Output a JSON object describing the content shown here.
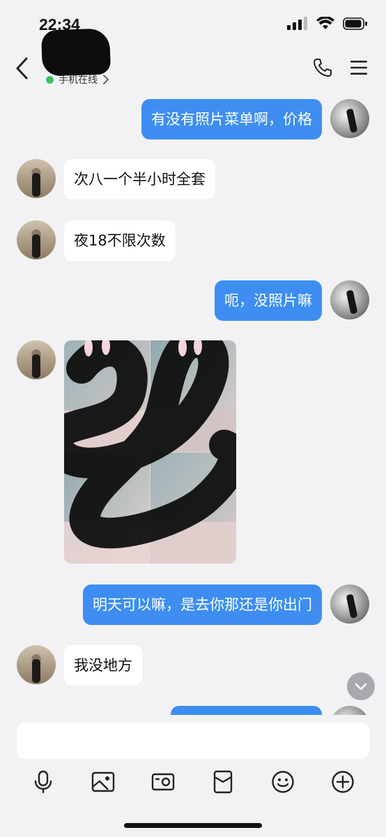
{
  "status": {
    "time": "22:34"
  },
  "header": {
    "presence": "手机在线"
  },
  "messages": [
    {
      "side": "me",
      "text": "有没有照片菜单啊，价格"
    },
    {
      "side": "them",
      "text": "次八一个半小时全套"
    },
    {
      "side": "them",
      "text": "夜18不限次数"
    },
    {
      "side": "me",
      "text": "呃，没照片嘛"
    },
    {
      "side": "them",
      "type": "image"
    },
    {
      "side": "me",
      "text": "明天可以嘛，是去你那还是你出门"
    },
    {
      "side": "them",
      "text": "我没地方"
    },
    {
      "side": "me",
      "text": ""
    }
  ],
  "input": {
    "value": ""
  },
  "toolbar_icons": [
    "microphone-icon",
    "image-icon",
    "camera-icon",
    "red-packet-icon",
    "emoji-icon",
    "plus-icon"
  ],
  "colors": {
    "my_bubble": "#3d8ef0",
    "their_bubble": "#ffffff",
    "background": "#f2f2f4",
    "online_dot": "#3ec064"
  }
}
